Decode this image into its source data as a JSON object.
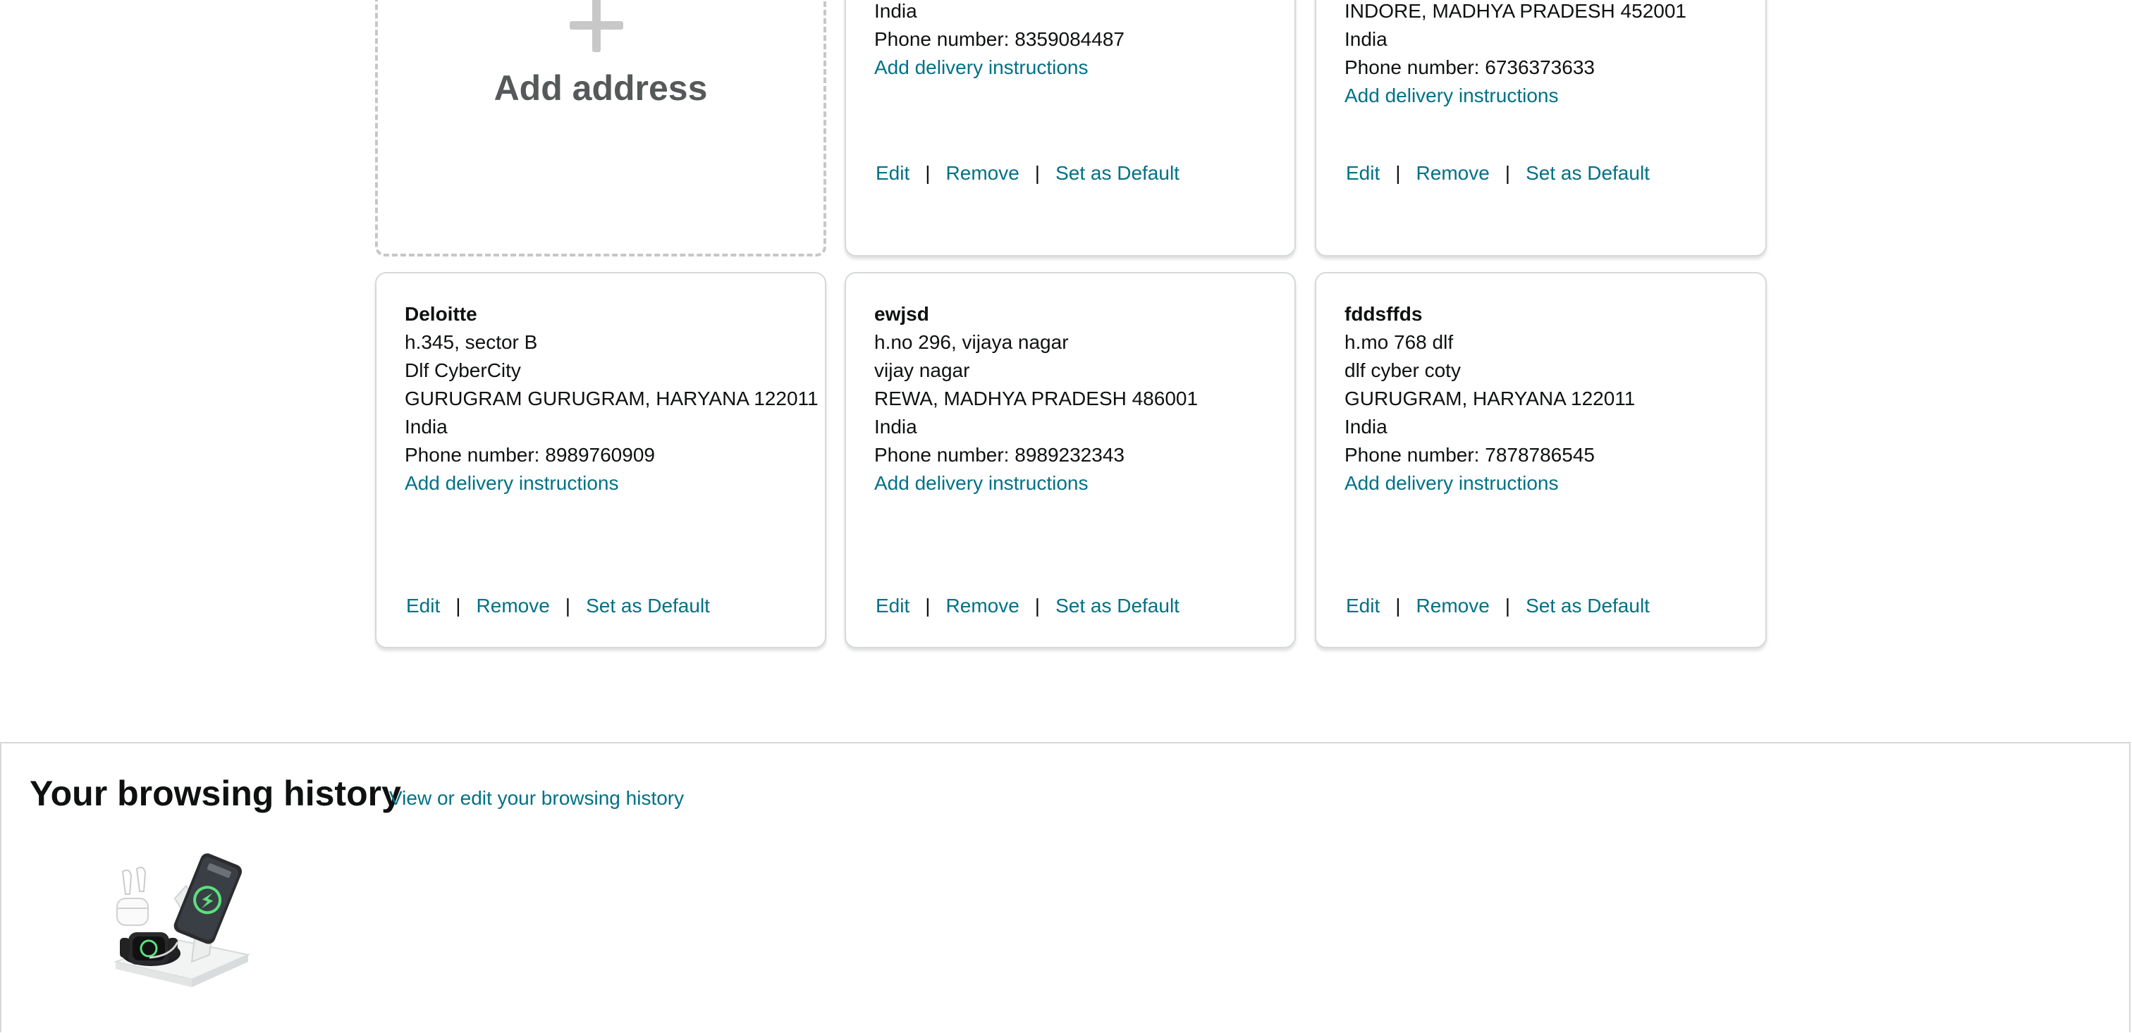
{
  "add_card": {
    "label": "Add address"
  },
  "top_cards": [
    {
      "lines": [
        "India",
        "Phone number: 8359084487"
      ],
      "delivery_link": "Add delivery instructions",
      "actions": {
        "edit": "Edit",
        "remove": "Remove",
        "default": "Set as Default"
      }
    },
    {
      "lines": [
        "INDORE, MADHYA PRADESH 452001",
        "India",
        "Phone number: 6736373633"
      ],
      "delivery_link": "Add delivery instructions",
      "actions": {
        "edit": "Edit",
        "remove": "Remove",
        "default": "Set as Default"
      }
    }
  ],
  "bottom_cards": [
    {
      "name": "Deloitte",
      "lines": [
        "h.345, sector B",
        "Dlf CyberCity",
        "GURUGRAM GURUGRAM, HARYANA 122011",
        "India",
        "Phone number: 8989760909"
      ],
      "delivery_link": "Add delivery instructions",
      "actions": {
        "edit": "Edit",
        "remove": "Remove",
        "default": "Set as Default"
      }
    },
    {
      "name": "ewjsd",
      "lines": [
        "h.no 296, vijaya nagar",
        "vijay nagar",
        "REWA, MADHYA PRADESH 486001",
        "India",
        "Phone number: 8989232343"
      ],
      "delivery_link": "Add delivery instructions",
      "actions": {
        "edit": "Edit",
        "remove": "Remove",
        "default": "Set as Default"
      }
    },
    {
      "name": "fddsffds",
      "lines": [
        "h.mo 768 dlf",
        "dlf cyber coty",
        "GURUGRAM, HARYANA 122011",
        "India",
        "Phone number: 7878786545"
      ],
      "delivery_link": "Add delivery instructions",
      "actions": {
        "edit": "Edit",
        "remove": "Remove",
        "default": "Set as Default"
      }
    }
  ],
  "browsing_history": {
    "title": "Your browsing history",
    "link": "View or edit your browsing history",
    "items": [
      {
        "icon": "wireless-charger-stand-product-image"
      }
    ]
  },
  "colors": {
    "link": "#007185",
    "text": "#0f1111",
    "card_border": "#d5d9d9",
    "dashed_border": "#c7c7c7"
  }
}
